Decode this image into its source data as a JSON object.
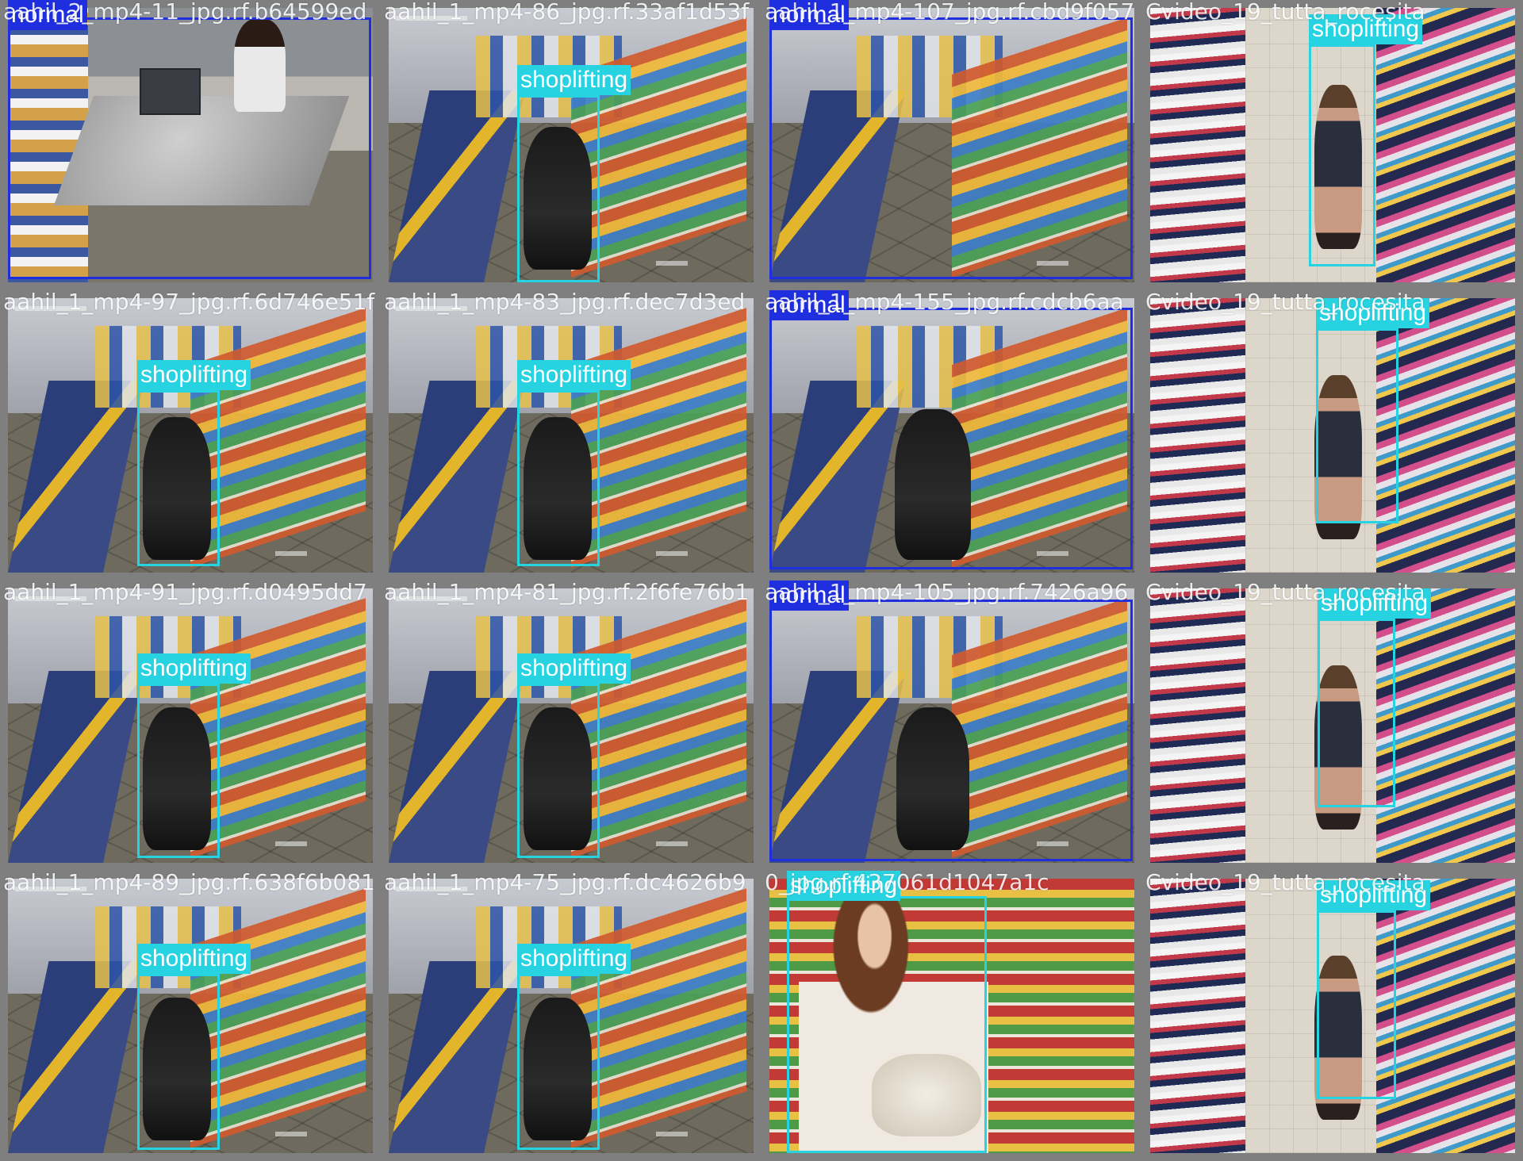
{
  "grid": {
    "columns": 4,
    "rows": 4
  },
  "colors": {
    "normal": "#1f2fe0",
    "shoplifting": "#27d3e0",
    "tile_border": "#7f7f7f"
  },
  "tiles": [
    {
      "filename": "aahil_2_mp4-11_jpg.rf.b64599ed",
      "scene": "counter",
      "detection": {
        "label": "normal"
      }
    },
    {
      "filename": "aahil_1_mp4-86_jpg.rf.33af1d53f",
      "scene": "cctv",
      "detection": {
        "label": "shoplifting"
      }
    },
    {
      "filename": "aahil_1_mp4-107_jpg.rf.cbd9f057",
      "scene": "cctv",
      "detection": {
        "label": "normal"
      }
    },
    {
      "filename": "Cvideo_19_tutta_rocesita",
      "scene": "aisle",
      "detection": {
        "label": "shoplifting"
      }
    },
    {
      "filename": "aahil_1_mp4-97_jpg.rf.6d746e51f",
      "scene": "cctv",
      "detection": {
        "label": "shoplifting"
      }
    },
    {
      "filename": "aahil_1_mp4-83_jpg.rf.dec7d3ed",
      "scene": "cctv",
      "detection": {
        "label": "shoplifting"
      }
    },
    {
      "filename": "aahil_1_mp4-155_jpg.rf.cdcb6aa",
      "scene": "cctv",
      "detection": {
        "label": "normal"
      }
    },
    {
      "filename": "Cvideo_19_tutta_rocesita",
      "scene": "aisle",
      "detection": {
        "label": "shoplifting"
      }
    },
    {
      "filename": "aahil_1_mp4-91_jpg.rf.d0495dd7",
      "scene": "cctv",
      "detection": {
        "label": "shoplifting"
      }
    },
    {
      "filename": "aahil_1_mp4-81_jpg.rf.2f6fe76b1",
      "scene": "cctv",
      "detection": {
        "label": "shoplifting"
      }
    },
    {
      "filename": "aahil_1_mp4-105_jpg.rf.7426a96",
      "scene": "cctv",
      "detection": {
        "label": "normal"
      }
    },
    {
      "filename": "Cvideo_19_tutta_rocesita",
      "scene": "aisle",
      "detection": {
        "label": "shoplifting"
      }
    },
    {
      "filename": "aahil_1_mp4-89_jpg.rf.638f6b081",
      "scene": "cctv",
      "detection": {
        "label": "shoplifting"
      }
    },
    {
      "filename": "aahil_1_mp4-75_jpg.rf.dc4626b9",
      "scene": "cctv",
      "detection": {
        "label": "shoplifting"
      }
    },
    {
      "filename": "0_jpg.rf.437061d1047a1c",
      "scene": "photo",
      "detection": {
        "label": "shoplifting"
      }
    },
    {
      "filename": "Cvideo_19_tutta_rocesita",
      "scene": "aisle",
      "detection": {
        "label": "shoplifting"
      }
    }
  ]
}
